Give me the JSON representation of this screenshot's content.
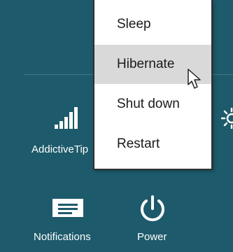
{
  "settings_pane": {
    "network_tile": {
      "label": "AddictiveTip",
      "icon": "signal-bars-icon"
    },
    "brightness_tile": {
      "icon": "brightness-icon"
    },
    "notifications_tile": {
      "label": "Notifications",
      "icon": "notifications-icon"
    },
    "power_tile": {
      "label": "Power",
      "icon": "power-icon"
    }
  },
  "power_menu": {
    "items": [
      {
        "label": "Sleep",
        "state": "normal"
      },
      {
        "label": "Hibernate",
        "state": "hover"
      },
      {
        "label": "Shut down",
        "state": "normal"
      },
      {
        "label": "Restart",
        "state": "normal"
      }
    ]
  },
  "colors": {
    "pane_background": "#1d5a6b",
    "menu_background": "#ffffff",
    "menu_hover": "#d9d9d9",
    "menu_border": "#2f2f2f"
  }
}
